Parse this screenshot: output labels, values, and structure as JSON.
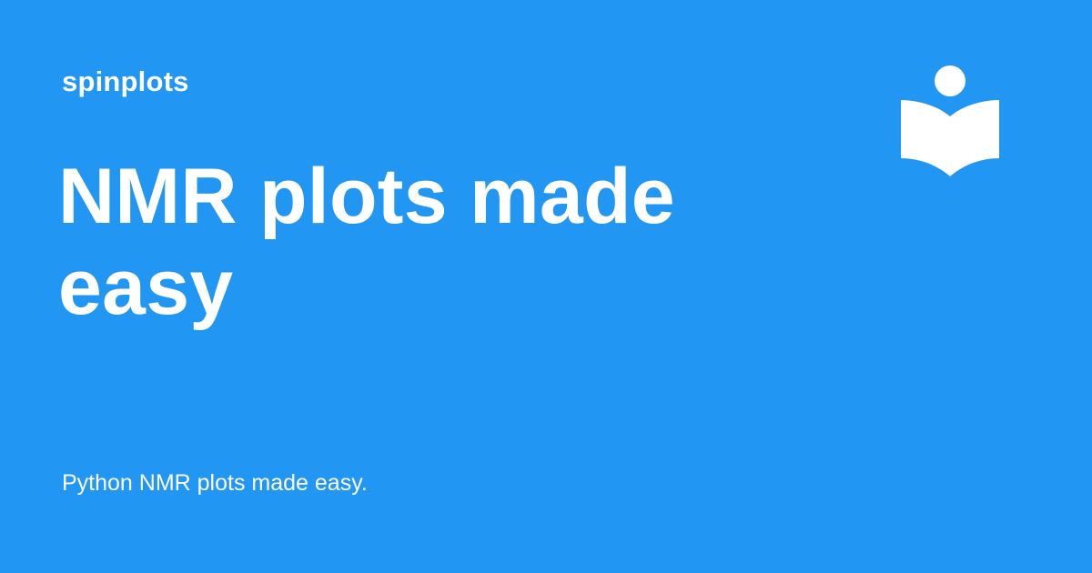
{
  "site": {
    "name": "spinplots"
  },
  "page": {
    "headline": "NMR plots made easy",
    "description": "Python NMR plots made easy."
  },
  "colors": {
    "background": "#2196f3",
    "foreground": "#ffffff"
  },
  "logo": {
    "icon": "book-reader-icon"
  }
}
